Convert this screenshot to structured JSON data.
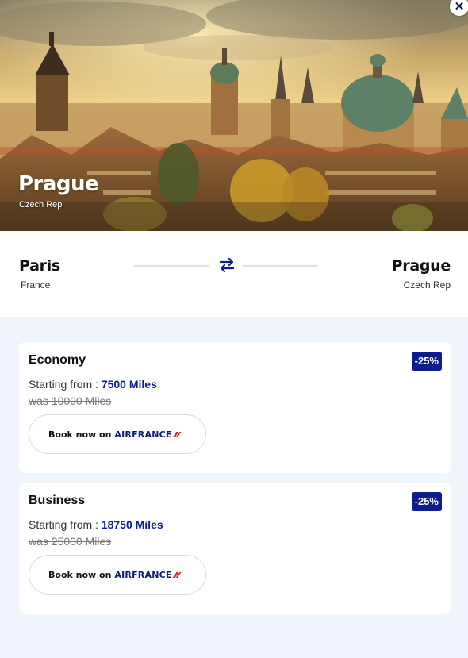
{
  "hero": {
    "city": "Prague",
    "country": "Czech Rep",
    "close_icon": "close-icon"
  },
  "route": {
    "from_city": "Paris",
    "from_country": "France",
    "to_city": "Prague",
    "to_country": "Czech Rep",
    "swap_icon": "swap-arrows-icon"
  },
  "offers": [
    {
      "cabin": "Economy",
      "discount": "-25%",
      "starting_label": "Starting from : ",
      "miles": "7500 Miles",
      "was": "was 10000 Miles",
      "book_label": "Book now on",
      "airline": "AIRFRANCE"
    },
    {
      "cabin": "Business",
      "discount": "-25%",
      "starting_label": "Starting from : ",
      "miles": "18750 Miles",
      "was": "was 25000 Miles",
      "book_label": "Book now on",
      "airline": "AIRFRANCE"
    }
  ],
  "colors": {
    "accent": "#0b1e8a",
    "airline_red": "#e0202b",
    "page_bg": "#f1f5fc"
  }
}
